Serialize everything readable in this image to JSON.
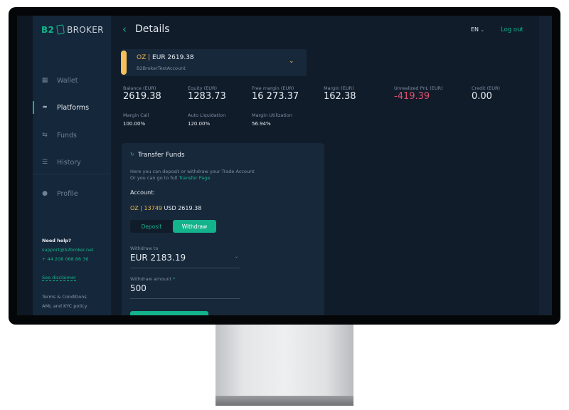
{
  "brand": {
    "logo_text_1": "B2",
    "logo_text_2": "BROKER"
  },
  "header": {
    "title": "Details",
    "language": "EN",
    "logout": "Log out"
  },
  "sidebar": {
    "items": [
      {
        "label": "Wallet",
        "icon": "grid-icon"
      },
      {
        "label": "Platforms",
        "icon": "chart-icon",
        "active": true
      },
      {
        "label": "Funds",
        "icon": "arrows-icon"
      },
      {
        "label": "History",
        "icon": "list-icon"
      },
      {
        "label": "Profile",
        "icon": "user-icon"
      }
    ],
    "help_title": "Need help?",
    "email": "support@b2broker.net",
    "phone": "+ 44 208 068 86 36",
    "disclaimer": "See disclaimer",
    "terms": "Terms & Conditions",
    "aml": "AML and KYC policy"
  },
  "account": {
    "platform": "OZ",
    "separator": "|",
    "balance": "EUR 2619.38",
    "name": "B2BrokerTestAccount"
  },
  "stats": [
    {
      "label": "Balance (EUR)",
      "value": "2619.38"
    },
    {
      "label": "Equity (EUR)",
      "value": "1283.73"
    },
    {
      "label": "Free margin (EUR)",
      "value": "16 273.37"
    },
    {
      "label": "Margin (EUR)",
      "value": "162.38"
    },
    {
      "label": "Unrealized PnL (EUR)",
      "value": "-419.39"
    },
    {
      "label": "Credit (EUR)",
      "value": "0.00"
    }
  ],
  "stats2": [
    {
      "label": "Margin Call",
      "value": "100.00%"
    },
    {
      "label": "Auto Liquidation",
      "value": "120.00%"
    },
    {
      "label": "Margin Utilization",
      "value": "56.94%"
    }
  ],
  "transfer": {
    "title": "Transfer Funds",
    "desc1": "Here you can deposit or withdraw your Trade Account",
    "desc2": "Or you can go to full ",
    "link": "Transfer Page",
    "account_label": "Account:",
    "acc_platform": "OZ | 13749",
    "acc_balance": " USD 2619.38",
    "tab_deposit": "Deposit",
    "tab_withdraw": "Withdraw",
    "withdraw_to_label": "Withdraw to",
    "withdraw_to_value": "EUR 2183.19",
    "amount_label": "Withdraw amount",
    "required": " *",
    "amount_value": "500"
  },
  "colors": {
    "accent": "#13b38b",
    "negative": "#e0506a",
    "highlight": "#f0b94d",
    "background": "#111c2b"
  }
}
